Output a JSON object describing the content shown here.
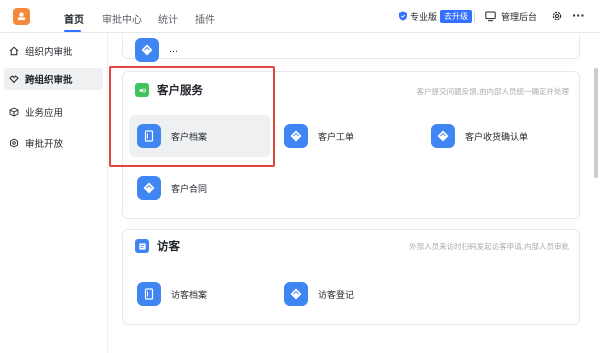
{
  "nav": {
    "tabs": [
      {
        "label": "首页"
      },
      {
        "label": "审批中心"
      },
      {
        "label": "统计"
      },
      {
        "label": "插件"
      }
    ],
    "active_tab": "首页",
    "plan_label": "专业版",
    "upgrade_label": "去升级",
    "admin_label": "管理后台"
  },
  "sidebar": {
    "items": [
      {
        "label": "组织内审批",
        "icon": "home-icon"
      },
      {
        "label": "跨组织审批",
        "icon": "handshake-icon"
      },
      {
        "label": "业务应用",
        "icon": "cube-icon"
      },
      {
        "label": "审批开放",
        "icon": "gear-icon"
      }
    ],
    "active_item": "跨组织审批"
  },
  "sections": [
    {
      "title": "客户服务",
      "description": "客户提交问题反馈,由内部人员统一确定并处理",
      "accent_color": "#3ec45a",
      "apps": [
        {
          "label": "客户档案",
          "icon": "file-folder-icon"
        },
        {
          "label": "客户工单",
          "icon": "document-stack-icon"
        },
        {
          "label": "客户收货确认单",
          "icon": "document-stack-icon"
        },
        {
          "label": "客户合同",
          "icon": "document-stack-icon"
        }
      ]
    },
    {
      "title": "访客",
      "description": "外部人员来访时扫码发起访客申请,内部人员审批",
      "accent_color": "#3f86f3",
      "apps": [
        {
          "label": "访客档案",
          "icon": "file-folder-icon"
        },
        {
          "label": "访客登记",
          "icon": "document-stack-icon"
        }
      ]
    }
  ],
  "top_partial_app": {
    "label": "…",
    "icon": "document-stack-icon"
  },
  "colors": {
    "brand": "#3370ff",
    "app_icon_bg": "#3f86f3",
    "highlight": "#e0463e",
    "logo": "#f5883a"
  }
}
